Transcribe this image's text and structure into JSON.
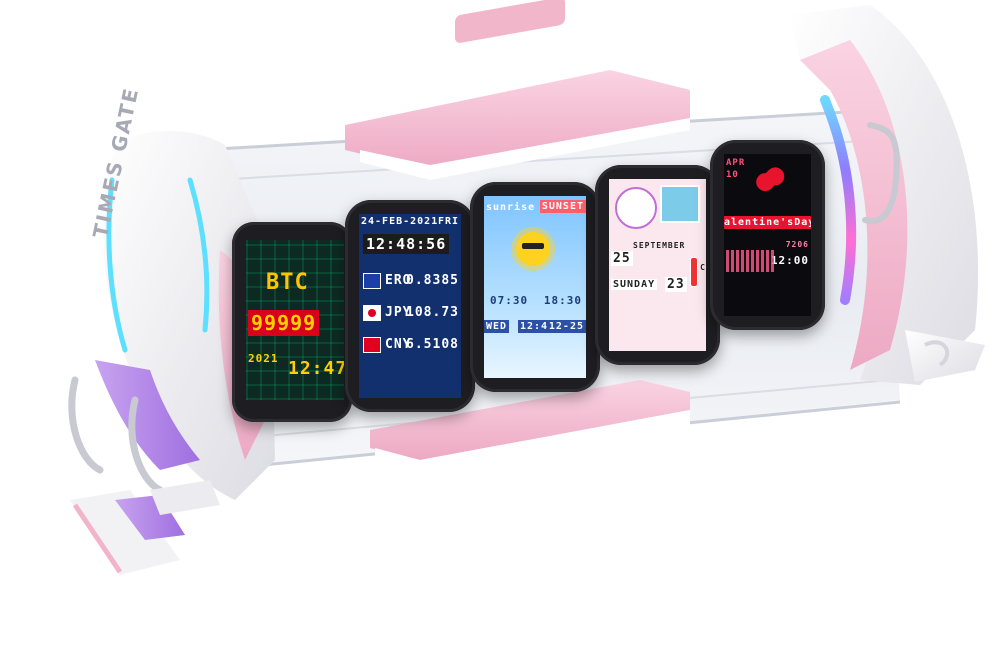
{
  "device": {
    "brand": "TIMES GATE"
  },
  "screens": {
    "btc": {
      "coin": "BTC",
      "price": "99999",
      "date": "2021",
      "time": "12:47"
    },
    "forex": {
      "date": "24-FEB-2021",
      "weekday": "FRI",
      "time": "12:48:56",
      "rows": [
        {
          "code": "ERO",
          "value": "0.8385"
        },
        {
          "code": "JPY",
          "value": "108.73"
        },
        {
          "code": "CNY",
          "value": "6.5108"
        }
      ]
    },
    "weather": {
      "sunrise_label": "sunrise",
      "sunset_label": "SUNSET",
      "sunrise_time": "07:30",
      "sunset_time": "18:30",
      "weekday": "WED",
      "time": "12:47",
      "date": "12-25"
    },
    "calendar": {
      "day": "25",
      "month": "SEPTEMBER",
      "weekday": "SUNDAY",
      "temp": "23",
      "unit": "C"
    },
    "valentine": {
      "month": "APR",
      "day": "10",
      "text": "alentine'sDay",
      "small": "7206",
      "time": "12:00"
    }
  },
  "colors": {
    "shell_pink": "#f5bfd3",
    "shell_white": "#f3f3f6",
    "accent_purple": "#b98ae8",
    "glow_cyan": "#5de0ff"
  }
}
